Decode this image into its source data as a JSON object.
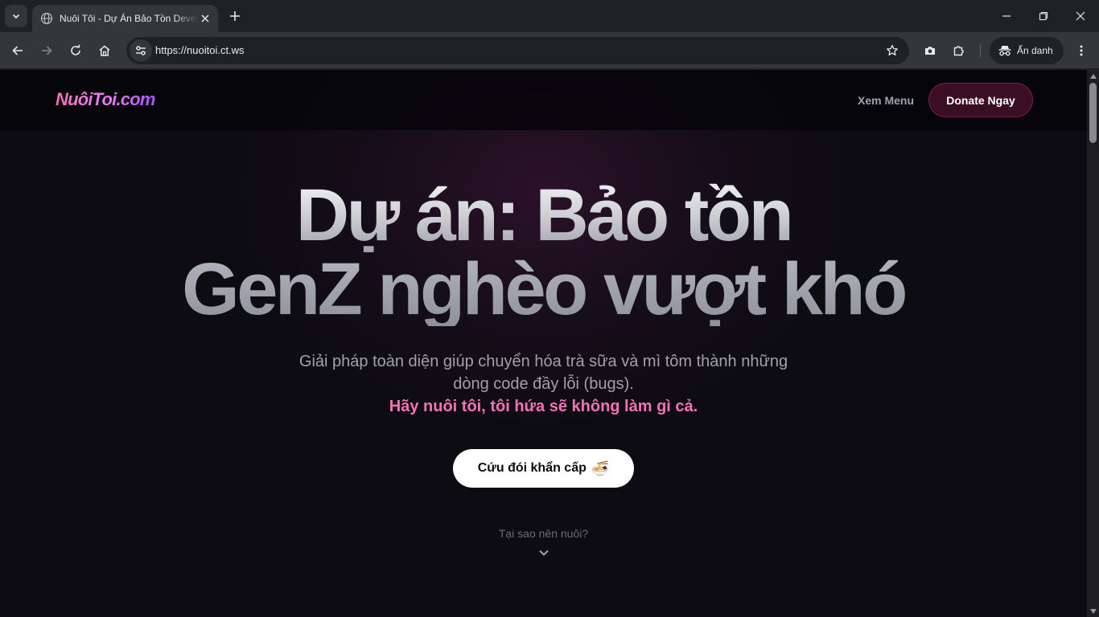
{
  "browser": {
    "tab_title": "Nuôi Tôi - Dự Án Bảo Tồn Developer",
    "url": "https://nuoitoi.ct.ws",
    "incognito_label": "Ẩn danh",
    "icons": {
      "tab_search": "chevron-down-icon",
      "favicon": "globe-icon",
      "close_tab": "close-icon",
      "new_tab": "plus-icon",
      "back": "arrow-left-icon",
      "forward": "arrow-right-icon",
      "reload": "reload-icon",
      "home": "home-icon",
      "site_info": "tune-icon",
      "bookmark": "star-icon",
      "screenshot": "camera-icon",
      "extensions": "puzzle-icon",
      "incognito": "incognito-icon",
      "menu": "more-vert-icon"
    }
  },
  "site": {
    "logo": "NuôiToi.com",
    "nav": {
      "menu_link": "Xem Menu",
      "donate_button": "Donate Ngay"
    },
    "hero": {
      "title_line1": "Dự án: Bảo tồn",
      "title_line2": "GenZ nghèo vượt khó",
      "subtitle_line1": "Giải pháp toàn diện giúp chuyển hóa trà sữa và mì tôm thành những",
      "subtitle_line2": "dòng code đầy lỗi (bugs).",
      "tagline": "Hãy nuôi tôi, tôi hứa sẽ không làm gì cả.",
      "cta_label": "Cứu đói khẩn cấp",
      "cta_emoji": "🍜",
      "why_label": "Tại sao nên nuôi?"
    }
  },
  "colors": {
    "accent_pink": "#f472b6",
    "background": "#0d0c12",
    "donate_bg": "#3a0f24"
  }
}
